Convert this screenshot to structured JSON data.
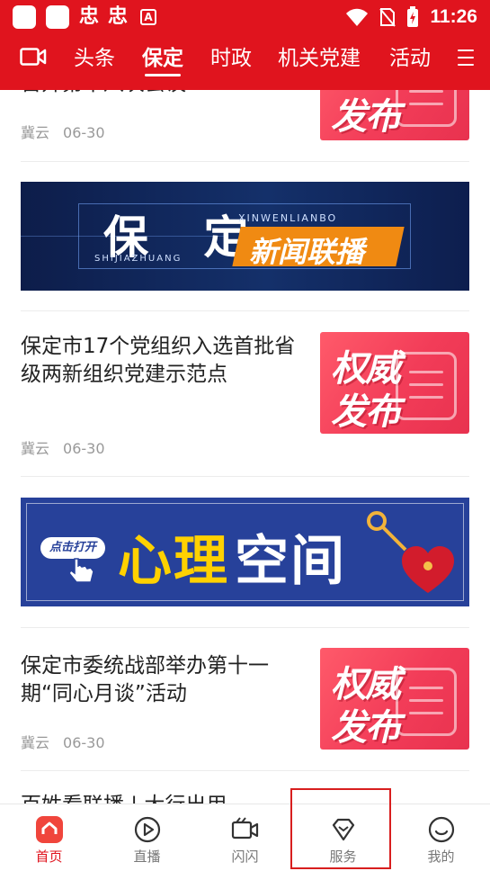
{
  "status_bar": {
    "app_glyphs": [
      "忠",
      "忠"
    ],
    "time": "11:26"
  },
  "top_nav": {
    "tabs": [
      {
        "label": "头条"
      },
      {
        "label": "保定",
        "active": true
      },
      {
        "label": "时政"
      },
      {
        "label": "机关党建"
      },
      {
        "label": "活动"
      }
    ],
    "accent_color": "#e0141e"
  },
  "feed": {
    "partial_top": {
      "title": "召开第十八次会议",
      "source": "冀云",
      "date": "06-30"
    },
    "banner_news": {
      "title": "保 定",
      "pinyin_city": "SHIJIAZHUANG",
      "pinyin_name": "XINWENLIANBO",
      "subtitle": "新闻联播"
    },
    "articles": [
      {
        "title": "保定市17个党组织入选首批省级两新组织党建示范点",
        "source": "冀云",
        "date": "06-30",
        "thumb_line1": "权威",
        "thumb_line2": "发布"
      },
      {
        "title": "保定市委统战部举办第十一期“同心月谈”活动",
        "source": "冀云",
        "date": "06-30",
        "thumb_line1": "权威",
        "thumb_line2": "发布"
      }
    ],
    "banner_mental": {
      "click_label": "点击打开",
      "word_yellow": "心理",
      "word_white": "空间"
    },
    "partial_bottom": {
      "title": "百姓看联播 | 大行出用"
    },
    "partial_top_thumb": "发布"
  },
  "bottom_tabs": [
    {
      "label": "首页",
      "icon": "home-icon",
      "active": true
    },
    {
      "label": "直播",
      "icon": "play-icon"
    },
    {
      "label": "闪闪",
      "icon": "video-camera-icon"
    },
    {
      "label": "服务",
      "icon": "diamond-icon"
    },
    {
      "label": "我的",
      "icon": "smile-icon"
    }
  ]
}
